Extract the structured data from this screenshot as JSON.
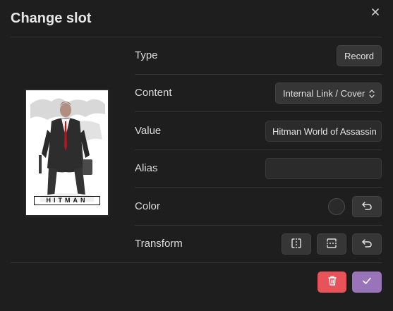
{
  "dialog": {
    "title": "Change slot"
  },
  "cover": {
    "caption": "HITMAN"
  },
  "fields": {
    "type": {
      "label": "Type",
      "button": "Record"
    },
    "content": {
      "label": "Content",
      "selected": "Internal Link / Cover"
    },
    "value": {
      "label": "Value",
      "text": "Hitman World of Assassin"
    },
    "alias": {
      "label": "Alias",
      "text": ""
    },
    "color": {
      "label": "Color",
      "swatch": "#2a2a2a"
    },
    "transform": {
      "label": "Transform"
    }
  },
  "colors": {
    "background": "#1e1e1e",
    "delete": "#e8535a",
    "confirm": "#9a74b9"
  },
  "icons": [
    "close-icon",
    "chevron-updown-icon",
    "undo-icon",
    "flip-horizontal-icon",
    "flip-vertical-icon",
    "trash-icon",
    "check-icon"
  ]
}
